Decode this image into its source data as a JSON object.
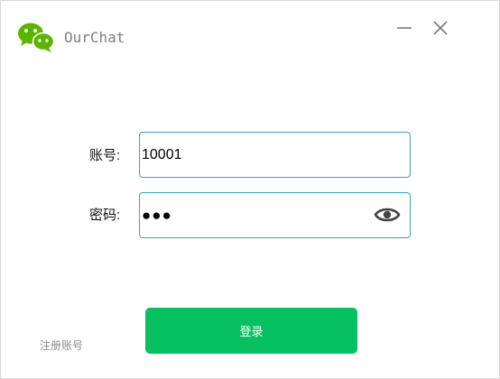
{
  "app": {
    "title": "OurChat",
    "logo_icon": "wechat-bubbles-icon",
    "brand_color": "#5cb400"
  },
  "window_controls": {
    "minimize_icon": "minimize-icon",
    "close_icon": "close-icon"
  },
  "form": {
    "account": {
      "label": "账号:",
      "value": "10001"
    },
    "password": {
      "label": "密码:",
      "masked_value": "●●●",
      "visibility_icon": "eye-icon"
    },
    "field_border_color": "#3ea0c8"
  },
  "actions": {
    "login_label": "登录",
    "register_label": "注册账号",
    "login_color": "#07c160"
  }
}
